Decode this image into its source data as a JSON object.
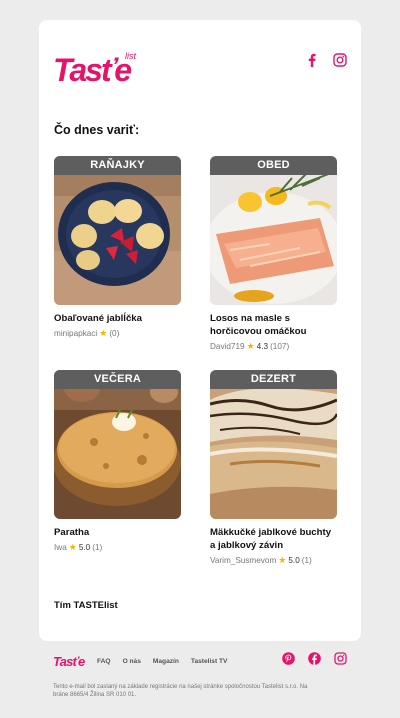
{
  "brand": {
    "name": "Tastelist",
    "accent": "#e5146a"
  },
  "header": {
    "logo_text": "Tasťe",
    "logo_small": "list"
  },
  "section": {
    "heading": "Čo dnes variť:"
  },
  "recipes": [
    {
      "tag": "RAŇAJKY",
      "title": "Obaľované jablĺčka",
      "author": "minipapkaci",
      "rating": "",
      "count": "(0)"
    },
    {
      "tag": "OBED",
      "title": "Losos na masle s horčicovou omáčkou",
      "author": "David719",
      "rating": "4.3",
      "count": "(107)"
    },
    {
      "tag": "VEČERA",
      "title": "Paratha",
      "author": "Iwa",
      "rating": "5.0",
      "count": "(1)"
    },
    {
      "tag": "DEZERT",
      "title": "Mäkkučké jablkové buchty a jablkový závin",
      "author": "Varim_Susmevom",
      "rating": "5.0",
      "count": "(1)"
    }
  ],
  "signoff": "Tím TASTElist",
  "footer": {
    "logo_text": "Tasťe",
    "nav": [
      "FAQ",
      "O nás",
      "Magazín",
      "Tastelist TV"
    ],
    "legal": "Tento e-mail bol zaslaný na základe registrácie na našej stránke spoločnostou Tastelist s.r.o. Na bráne 8665/4 Žilina SR 010 01."
  },
  "icons": {
    "top": [
      "facebook-icon",
      "instagram-icon"
    ],
    "footer": [
      "pinterest-icon",
      "facebook-icon",
      "instagram-icon"
    ]
  }
}
